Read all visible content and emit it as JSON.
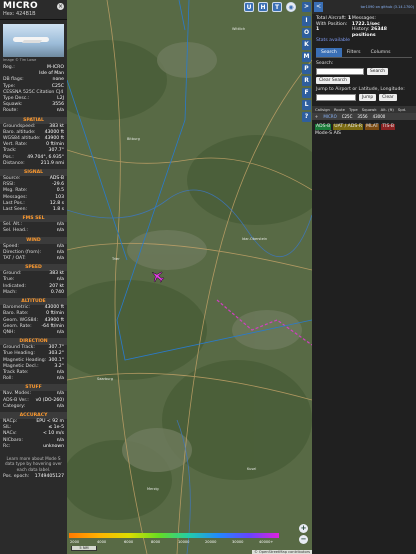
{
  "info": {
    "callsign": "MICRO",
    "hex_label": "Hex:",
    "hex": "424B1B",
    "close": "×",
    "photo_credit": "Image © Tim Lowe",
    "identity": [
      {
        "k": "Reg.:",
        "v": "M-ICRO"
      },
      {
        "k": "",
        "v": "Isle of Man"
      },
      {
        "k": "DB flags:",
        "v": "none"
      },
      {
        "k": "Type:",
        "v": "C25C"
      },
      {
        "k": "CESSNA 525C Citation CJ4",
        "v": ""
      },
      {
        "k": "Type Desc.:",
        "v": "L2J"
      },
      {
        "k": "Squawk:",
        "v": "3556"
      },
      {
        "k": "Route:",
        "v": "n/a"
      }
    ],
    "sections": [
      {
        "title": "SPATIAL",
        "rows": [
          {
            "k": "Groundspeed:",
            "v": "383 kt"
          },
          {
            "k": "Baro. altitude:",
            "v": "43000 ft"
          },
          {
            "k": "WGS84 altitude:",
            "v": "43900 ft"
          },
          {
            "k": "Vert. Rate:",
            "v": "0 ft/min"
          },
          {
            "k": "Track:",
            "v": "307.7°"
          },
          {
            "k": "Pos.:",
            "v": "49.704°, 6.935°"
          },
          {
            "k": "Distance:",
            "v": "211.9 nmi"
          }
        ]
      },
      {
        "title": "SIGNAL",
        "rows": [
          {
            "k": "Source:",
            "v": "ADS-B"
          },
          {
            "k": "RSSI:",
            "v": "-29.6"
          },
          {
            "k": "Msg. Rate:",
            "v": "0.5"
          },
          {
            "k": "Messages:",
            "v": "103"
          },
          {
            "k": "Last Pos.:",
            "v": "12.8 s"
          },
          {
            "k": "Last Seen:",
            "v": "1.8 s"
          }
        ]
      },
      {
        "title": "FMS SEL",
        "rows": [
          {
            "k": "Sel. Alt.:",
            "v": "n/a"
          },
          {
            "k": "Sel. Head.:",
            "v": "n/a"
          }
        ]
      },
      {
        "title": "WIND",
        "rows": [
          {
            "k": "Speed:",
            "v": "n/a"
          },
          {
            "k": "Direction (from):",
            "v": "n/a"
          },
          {
            "k": "TAT / OAT:",
            "v": "n/a"
          }
        ]
      },
      {
        "title": "SPEED",
        "rows": [
          {
            "k": "Ground:",
            "v": "383 kt"
          },
          {
            "k": "True:",
            "v": "n/a"
          },
          {
            "k": "Indicated:",
            "v": "207 kt"
          },
          {
            "k": "Mach:",
            "v": "0.740"
          }
        ]
      },
      {
        "title": "ALTITUDE",
        "rows": [
          {
            "k": "Barometric:",
            "v": "43000 ft"
          },
          {
            "k": "Baro. Rate:",
            "v": "0 ft/min"
          },
          {
            "k": "Geom. WGS84:",
            "v": "43900 ft"
          },
          {
            "k": "Geom. Rate:",
            "v": "-64 ft/min"
          },
          {
            "k": "QNH:",
            "v": "n/a"
          }
        ]
      },
      {
        "title": "DIRECTION",
        "rows": [
          {
            "k": "Ground Track:",
            "v": "307.7°"
          },
          {
            "k": "True Heading:",
            "v": "303.2°"
          },
          {
            "k": "Magnetic Heading:",
            "v": "300.1°"
          },
          {
            "k": "Magnetic Decl.:",
            "v": "3.2°"
          },
          {
            "k": "Track Rate:",
            "v": "n/a"
          },
          {
            "k": "Roll:",
            "v": "n/a"
          }
        ]
      },
      {
        "title": "STUFF",
        "rows": [
          {
            "k": "Nav. Modes:",
            "v": "n/a"
          },
          {
            "k": "ADS-B Ver.:",
            "v": "v0 (DO-260)"
          },
          {
            "k": "Category:",
            "v": "n/a"
          }
        ]
      },
      {
        "title": "ACCURACY",
        "rows": [
          {
            "k": "NACp:",
            "v": "EPU < 92 m"
          },
          {
            "k": "SIL:",
            "v": "≤ 1e-5"
          },
          {
            "k": "NACv:",
            "v": "< 10 m/s"
          },
          {
            "k": "NICbaro:",
            "v": "n/a"
          },
          {
            "k": "Rc:",
            "v": "unknown"
          }
        ]
      }
    ],
    "note": "Learn more about Mode S data type by hovering over each data label.",
    "epoch_label": "Pos. epoch:",
    "epoch": "1749405127"
  },
  "map": {
    "top_buttons": [
      "U",
      "H",
      "T"
    ],
    "side_buttons": [
      "I",
      "O",
      "K",
      "M",
      "P",
      "R",
      "F",
      "L",
      "?"
    ],
    "legend_labels": [
      "2000",
      "4000",
      "6000",
      "8000",
      "10000",
      "20000",
      "30000",
      "40000+"
    ],
    "scale": "5 NM",
    "attribution": "© OpenStreetMap contributors",
    "zoom_in": "+",
    "zoom_out": "−",
    "towns": [
      "Wittlich",
      "Trier",
      "Bitburg",
      "Saarburg",
      "Merzig",
      "Idar-Oberstein",
      "Kusel"
    ]
  },
  "panel": {
    "collapse": "<",
    "expand": ">",
    "github": "tar1090 on github (3.14.1700)",
    "total_label": "Total Aircraft:",
    "total": "1",
    "messages_label": "Messages:",
    "messages": "1722.1/sec",
    "with_pos_label": "With Position:",
    "with_pos": "1",
    "history_label": "History:",
    "history": "26348 positions",
    "stats": "Stats available",
    "tabs": [
      "Search",
      "Filters",
      "Columns"
    ],
    "search_label": "Search:",
    "search_button": "Search",
    "clear_search": "Clear Search",
    "jump_label": "Jump to Airport or Latitude, Longitude:",
    "jump_button": "Jump",
    "clear_button": "Clear",
    "columns": [
      "Callsign",
      "Route",
      "Type",
      "Squawk",
      "Alt. (ft)",
      "Spd."
    ],
    "row": {
      "callsign": "MICRO",
      "type": "C25C",
      "squawk": "3556",
      "alt": "43000"
    },
    "sources": [
      {
        "label": "ADS-B",
        "color": "#1b7a3a"
      },
      {
        "label": "UAT / ADS-R",
        "color": "#7a6a12"
      },
      {
        "label": "MLAT",
        "color": "#7a4a12"
      },
      {
        "label": "TIS-B",
        "color": "#8a2222"
      }
    ],
    "mode_s": "Mode-S",
    "ais": "AIS"
  }
}
